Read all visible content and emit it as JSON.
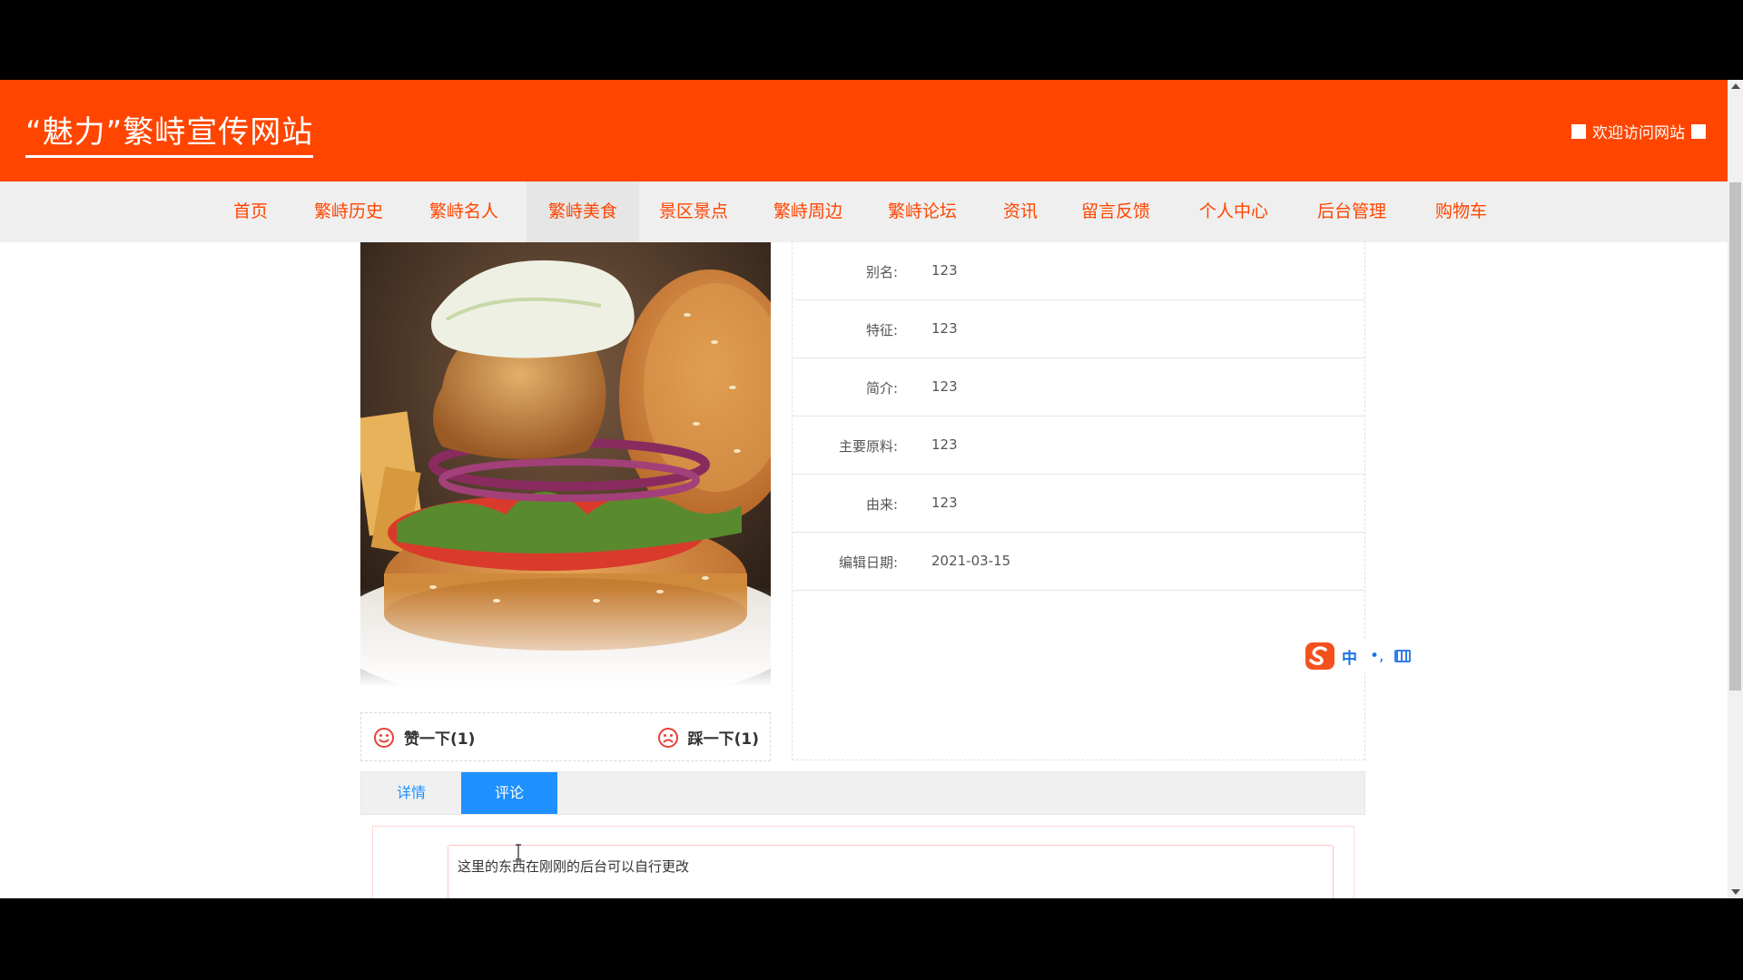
{
  "header": {
    "site_title": "“魅力”繁峙宣传网站",
    "welcome_text": "欢迎访问网站"
  },
  "nav": {
    "items": [
      {
        "label": "首页"
      },
      {
        "label": "繁峙历史"
      },
      {
        "label": "繁峙名人"
      },
      {
        "label": "繁峙美食",
        "active": true
      },
      {
        "label": "景区景点"
      },
      {
        "label": "繁峙周边"
      },
      {
        "label": "繁峙论坛"
      },
      {
        "label": "资讯"
      },
      {
        "label": "留言反馈"
      },
      {
        "label": "个人中心"
      },
      {
        "label": "后台管理"
      },
      {
        "label": "购物车"
      }
    ],
    "accent_color": "#ff4500"
  },
  "product": {
    "image_icon": "burger-photo"
  },
  "votes": {
    "like_label": "赞一下(1)",
    "dislike_label": "踩一下(1)",
    "like_icon": "smile-icon",
    "dislike_icon": "frown-icon"
  },
  "info": {
    "rows": [
      {
        "label": "别名:",
        "value": "123"
      },
      {
        "label": "特征:",
        "value": "123"
      },
      {
        "label": "简介:",
        "value": "123"
      },
      {
        "label": "主要原料:",
        "value": "123"
      },
      {
        "label": "由来:",
        "value": "123"
      },
      {
        "label": "编辑日期:",
        "value": "2021-03-15"
      }
    ]
  },
  "ime": {
    "mode": "中",
    "punct": "•,"
  },
  "tabs": {
    "details": "详情",
    "comment": "评论",
    "active": "comment"
  },
  "comment_form": {
    "label": "评论",
    "value": "这里的东西在刚刚的后台可以自行更改"
  }
}
